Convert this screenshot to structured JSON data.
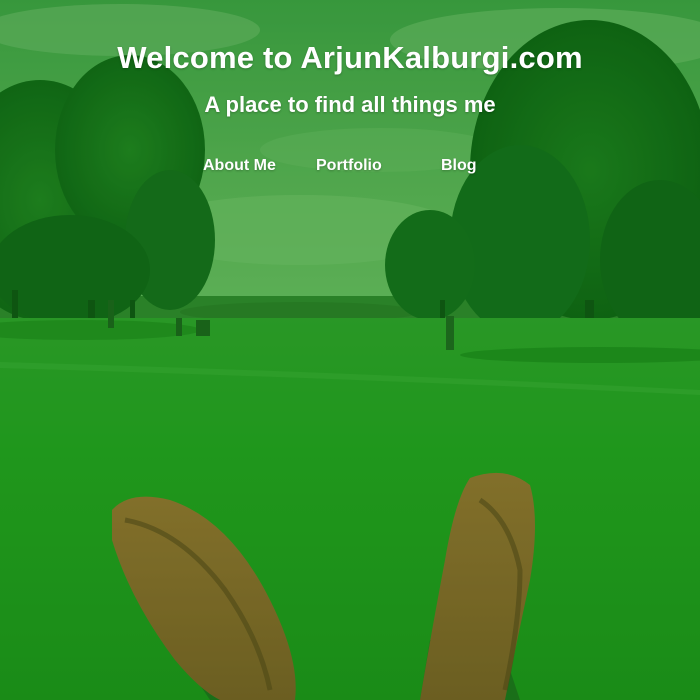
{
  "header": {
    "title": "Welcome to ArjunKalburgi.com",
    "subtitle": "A place to find all things me"
  },
  "nav": {
    "items": [
      {
        "label": "About Me"
      },
      {
        "label": "Portfolio"
      },
      {
        "label": "Blog"
      }
    ]
  },
  "background": {
    "description_icon": "park-lawn-photo",
    "tint_color": "#1f8a1f"
  }
}
